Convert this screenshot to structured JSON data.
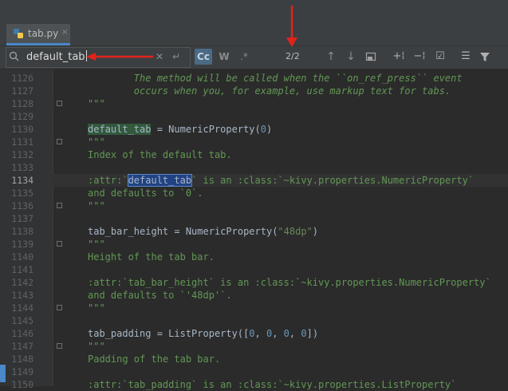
{
  "editor": {
    "tab": {
      "filename": "tab.py",
      "close_icon": "×"
    },
    "find": {
      "query": "default_tab",
      "match_counter": "2/2",
      "case_label": "Cc",
      "word_label": "W",
      "regex_label": ".*"
    },
    "annotation_color": "#e0241b",
    "lines": [
      {
        "n": "1126",
        "fold": false,
        "parts": [
          {
            "c": "docital",
            "t": "        The method will be called when the ``on_ref_press`` event"
          }
        ]
      },
      {
        "n": "1127",
        "fold": false,
        "parts": [
          {
            "c": "docital",
            "t": "        occurs when you, for example, use markup text for tabs."
          }
        ]
      },
      {
        "n": "1128",
        "fold": true,
        "parts": [
          {
            "c": "doc",
            "t": "\"\"\""
          }
        ]
      },
      {
        "n": "1129",
        "fold": false,
        "parts": []
      },
      {
        "n": "1130",
        "fold": false,
        "parts": [
          {
            "c": "hl-name",
            "t": "default_tab"
          },
          {
            "c": "plain",
            "t": " = NumericProperty("
          },
          {
            "c": "num",
            "t": "0"
          },
          {
            "c": "plain",
            "t": ")"
          }
        ]
      },
      {
        "n": "1131",
        "fold": true,
        "parts": [
          {
            "c": "doc",
            "t": "\"\"\""
          }
        ]
      },
      {
        "n": "1132",
        "fold": false,
        "parts": [
          {
            "c": "doc",
            "t": "Index of the default tab."
          }
        ]
      },
      {
        "n": "1133",
        "fold": false,
        "parts": []
      },
      {
        "n": "1134",
        "fold": false,
        "current": true,
        "parts": [
          {
            "c": "doc",
            "t": ":attr:`"
          },
          {
            "c": "hl-sel",
            "t": "default_tab"
          },
          {
            "c": "doc",
            "t": "` is an :class:`~kivy.properties.NumericProperty`"
          }
        ]
      },
      {
        "n": "1135",
        "fold": false,
        "parts": [
          {
            "c": "doc",
            "t": "and defaults to `0`."
          }
        ]
      },
      {
        "n": "1136",
        "fold": true,
        "parts": [
          {
            "c": "doc",
            "t": "\"\"\""
          }
        ]
      },
      {
        "n": "1137",
        "fold": false,
        "parts": []
      },
      {
        "n": "1138",
        "fold": false,
        "parts": [
          {
            "c": "plain",
            "t": "tab_bar_height = NumericProperty("
          },
          {
            "c": "str",
            "t": "\"48dp\""
          },
          {
            "c": "plain",
            "t": ")"
          }
        ]
      },
      {
        "n": "1139",
        "fold": true,
        "parts": [
          {
            "c": "doc",
            "t": "\"\"\""
          }
        ]
      },
      {
        "n": "1140",
        "fold": false,
        "parts": [
          {
            "c": "doc",
            "t": "Height of the tab bar."
          }
        ]
      },
      {
        "n": "1141",
        "fold": false,
        "parts": []
      },
      {
        "n": "1142",
        "fold": false,
        "parts": [
          {
            "c": "doc",
            "t": ":attr:`tab_bar_height` is an :class:`~kivy.properties.NumericProperty`"
          }
        ]
      },
      {
        "n": "1143",
        "fold": false,
        "parts": [
          {
            "c": "doc",
            "t": "and defaults to `'48dp'`."
          }
        ]
      },
      {
        "n": "1144",
        "fold": true,
        "parts": [
          {
            "c": "doc",
            "t": "\"\"\""
          }
        ]
      },
      {
        "n": "1145",
        "fold": false,
        "parts": []
      },
      {
        "n": "1146",
        "fold": false,
        "parts": [
          {
            "c": "plain",
            "t": "tab_padding = ListProperty(["
          },
          {
            "c": "num",
            "t": "0"
          },
          {
            "c": "plain",
            "t": ", "
          },
          {
            "c": "num",
            "t": "0"
          },
          {
            "c": "plain",
            "t": ", "
          },
          {
            "c": "num",
            "t": "0"
          },
          {
            "c": "plain",
            "t": ", "
          },
          {
            "c": "num",
            "t": "0"
          },
          {
            "c": "plain",
            "t": "])"
          }
        ]
      },
      {
        "n": "1147",
        "fold": true,
        "parts": [
          {
            "c": "doc",
            "t": "\"\"\""
          }
        ]
      },
      {
        "n": "1148",
        "fold": false,
        "parts": [
          {
            "c": "doc",
            "t": "Padding of the tab bar."
          }
        ]
      },
      {
        "n": "1149",
        "fold": false,
        "parts": []
      },
      {
        "n": "1150",
        "fold": false,
        "parts": [
          {
            "c": "doc",
            "t": ":attr:`tab_padding` is an :class:`~kivy.properties.ListProperty`"
          }
        ]
      }
    ]
  }
}
